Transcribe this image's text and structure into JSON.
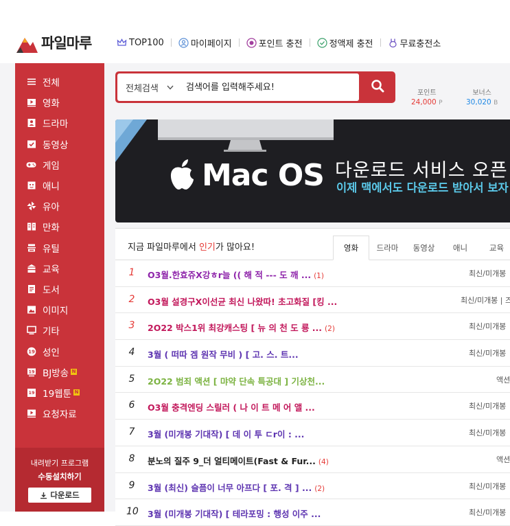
{
  "brand": {
    "name": "파일마루"
  },
  "topnav": [
    {
      "label": "TOP100",
      "icon": "crown-icon"
    },
    {
      "label": "마이페이지",
      "icon": "user-icon"
    },
    {
      "label": "포인트 충전",
      "icon": "coin-icon"
    },
    {
      "label": "정액제 충전",
      "icon": "check-circle-icon"
    },
    {
      "label": "무료충전소",
      "icon": "rabbit-icon"
    }
  ],
  "sidebar": {
    "items": [
      {
        "label": "전체",
        "icon": "menu-icon"
      },
      {
        "label": "영화",
        "icon": "play-icon"
      },
      {
        "label": "드라마",
        "icon": "person-icon"
      },
      {
        "label": "동영상",
        "icon": "check-box-icon"
      },
      {
        "label": "게임",
        "icon": "gamepad-icon"
      },
      {
        "label": "애니",
        "icon": "anime-face-icon"
      },
      {
        "label": "유아",
        "icon": "pinwheel-icon"
      },
      {
        "label": "만화",
        "icon": "book-open-icon"
      },
      {
        "label": "유틸",
        "icon": "tools-icon"
      },
      {
        "label": "교육",
        "icon": "school-icon"
      },
      {
        "label": "도서",
        "icon": "document-icon"
      },
      {
        "label": "이미지",
        "icon": "image-icon"
      },
      {
        "label": "기타",
        "icon": "monitor-icon"
      },
      {
        "label": "성인",
        "icon": "adult-19-icon"
      },
      {
        "label": "BJ방송",
        "icon": "broadcast-icon",
        "badge": "N"
      },
      {
        "label": "19웹툰",
        "icon": "webtoon-19-icon",
        "badge": "N"
      },
      {
        "label": "요청자료",
        "icon": "request-icon"
      }
    ],
    "download_program": {
      "line1": "내려받기 프로그램",
      "line2": "수동설치하기",
      "button": "다운로드"
    }
  },
  "search": {
    "category": "전체검색",
    "placeholder": "검색어를 입력해주세요!"
  },
  "points": [
    {
      "label": "포인트",
      "value": "24,000",
      "unit": "P",
      "color": "#e53935"
    },
    {
      "label": "보너스",
      "value": "30,020",
      "unit": "B",
      "color": "#1e88e5"
    }
  ],
  "banner": {
    "logo_text": "Mac OS",
    "headline": "다운로드 서비스 오픈",
    "subline": "이제 맥에서도 다운로드 받아서 보자"
  },
  "popular": {
    "title_prefix": "지금 파일마루에서 ",
    "title_highlight": "인기",
    "title_suffix": "가 많아요!",
    "tabs": [
      "영화",
      "드라마",
      "동영상",
      "애니",
      "교육"
    ],
    "active_tab": 0,
    "rows": [
      {
        "rank": "1",
        "title": "O3월.한효쥬X강ㅎr늘 (( 해 적 --- 도 깨 ...",
        "count": "(1)",
        "category": "최신/미개봉",
        "color": "#8e24aa"
      },
      {
        "rank": "2",
        "title": "O3월 설경구X이선균 최신 나왔따! 초고화질 [킹 ...",
        "count": "",
        "category": "최신/미개봉 | 즈",
        "color": "#c2185b"
      },
      {
        "rank": "3",
        "title": "2O22 박스1위 최강캐스팅 [ 뉴 의 천 도 룡 ...",
        "count": "(2)",
        "category": "최신/미개봉",
        "color": "#c2185b"
      },
      {
        "rank": "4",
        "title": "3월 ( 떠따 겜 원작 무비 ) [ 고. 스. 트...",
        "count": "",
        "category": "최신/미개봉",
        "color": "#5e35b1"
      },
      {
        "rank": "5",
        "title": "2O22 범죄 액션 [ 먀약 단속 특공대 ] 기상천...",
        "count": "",
        "category": "액션",
        "color": "#7cb342"
      },
      {
        "rank": "6",
        "title": "O3월 충격엔딩 스릴러 ( 나 이 트 메 어 앨 ...",
        "count": "",
        "category": "최신/미개봉",
        "color": "#c2185b"
      },
      {
        "rank": "7",
        "title": "3월 (미개봉 기대작) [ 데 이 투 ㄷr이 : ...",
        "count": "",
        "category": "최신/미개봉",
        "color": "#5e35b1"
      },
      {
        "rank": "8",
        "title": "분노의 질주 9_더 얼티메이트(Fast & Fur...",
        "count": "(4)",
        "category": "액션",
        "color": "#222222"
      },
      {
        "rank": "9",
        "title": "3월 (최신) 슬픔이 너무 아프다 [ 포. 격 ] ...",
        "count": "(2)",
        "category": "최신/미개봉",
        "color": "#5e35b1"
      },
      {
        "rank": "10",
        "title": "3월 (미개봉 기대작) [ 테라포밍 : 행성 이주 ...",
        "count": "",
        "category": "최신/미개봉",
        "color": "#5e35b1"
      }
    ]
  }
}
